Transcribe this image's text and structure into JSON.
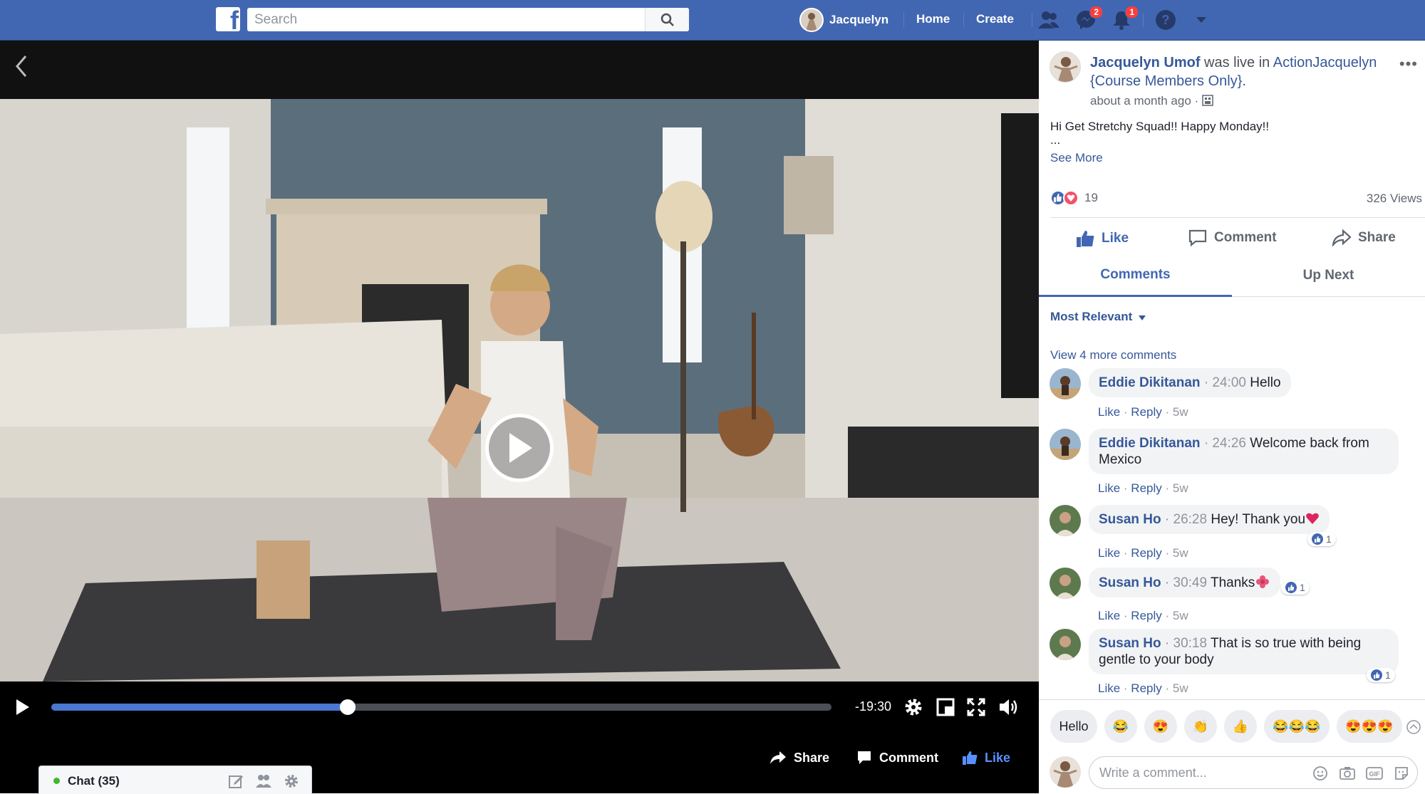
{
  "topbar": {
    "logo": "f",
    "search_placeholder": "Search",
    "user_name": "Jacquelyn",
    "home": "Home",
    "create": "Create",
    "messages_badge": "2",
    "notifications_badge": "1"
  },
  "video": {
    "time_remaining": "-19:30",
    "progress_fraction": 0.38,
    "actions": {
      "share": "Share",
      "comment": "Comment",
      "like": "Like"
    }
  },
  "chat": {
    "label": "Chat (35)"
  },
  "post": {
    "author": "Jacquelyn Umof",
    "was_live_in": "was live in",
    "group": "ActionJacquelyn {Course Members Only}",
    "period": ".",
    "time": "about a month ago",
    "separator": "·",
    "text": "Hi Get Stretchy Squad!! Happy Monday!!",
    "ellipsis": "...",
    "see_more": "See More",
    "reaction_count": "19",
    "views": "326 Views",
    "actions": {
      "like": "Like",
      "comment": "Comment",
      "share": "Share"
    },
    "tabs": [
      "Comments",
      "Up Next"
    ],
    "sort": "Most Relevant",
    "view_more": "View 4 more comments"
  },
  "comments": [
    {
      "name": "Eddie Dikitanan",
      "ts": "24:00",
      "text": "Hello",
      "like": "Like",
      "reply": "Reply",
      "age": "5w",
      "likes": ""
    },
    {
      "name": "Eddie Dikitanan",
      "ts": "24:26",
      "text": "Welcome back from Mexico",
      "like": "Like",
      "reply": "Reply",
      "age": "5w",
      "likes": ""
    },
    {
      "name": "Susan Ho",
      "ts": "26:28",
      "text": "Hey! Thank you",
      "like": "Like",
      "reply": "Reply",
      "age": "5w",
      "likes": "1"
    },
    {
      "name": "Susan Ho",
      "ts": "30:49",
      "text": "Thanks",
      "like": "Like",
      "reply": "Reply",
      "age": "5w",
      "likes": "1"
    },
    {
      "name": "Susan Ho",
      "ts": "30:18",
      "text": "That is so true with being gentle to your body",
      "like": "Like",
      "reply": "Reply",
      "age": "5w",
      "likes": "1"
    }
  ],
  "quick_replies": [
    "Hello",
    "😂",
    "😍",
    "👏",
    "👍",
    "😂😂😂",
    "😍😍😍"
  ],
  "composer": {
    "placeholder": "Write a comment..."
  },
  "colors": {
    "brand": "#4267b2",
    "link": "#365899",
    "progress": "#4a78d0"
  }
}
